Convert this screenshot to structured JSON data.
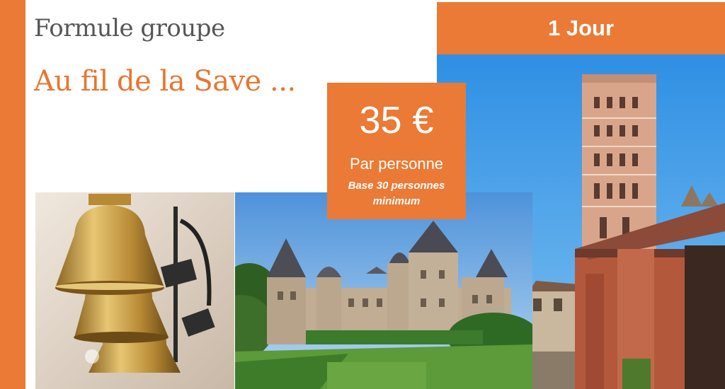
{
  "header": {
    "kicker": "Formule groupe",
    "title": "Au fil de la Save ..."
  },
  "duration_badge": {
    "label": "1 Jour"
  },
  "price_box": {
    "amount": "35 €",
    "unit": "Par personne",
    "basis": "Base 30 personnes minimum"
  },
  "photos": [
    "bells-photo",
    "castle-photo",
    "tower-photo"
  ],
  "colors": {
    "accent": "#ea7a35",
    "heading_grey": "#565656",
    "sky": "#4ea3e6"
  }
}
